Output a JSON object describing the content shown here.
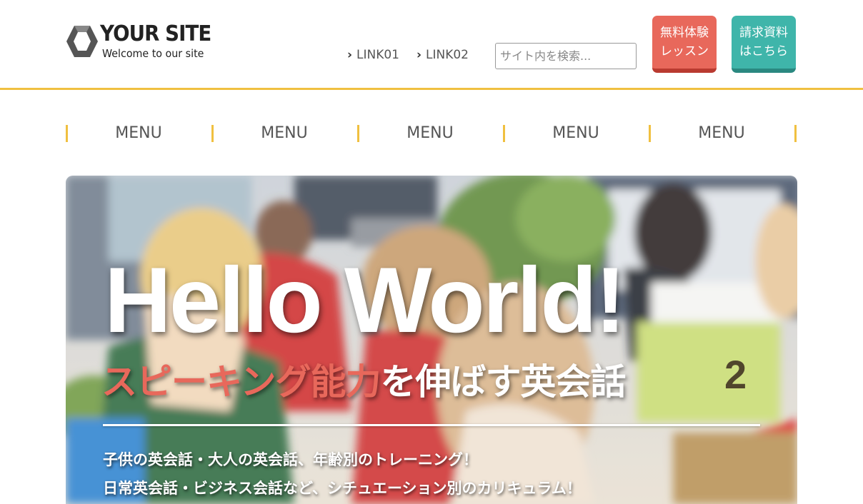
{
  "header": {
    "logo_title": "YOUR SITE",
    "logo_tagline": "Welcome to our site",
    "links": [
      {
        "label": "LINK01"
      },
      {
        "label": "LINK02"
      }
    ],
    "search_placeholder": "サイト内を検索...",
    "cta_trial": "無料体験\nレッスン",
    "cta_request": "請求資料\nはこちら",
    "accent_color": "#f0c040",
    "cta_trial_color": "#e8685b",
    "cta_request_color": "#3fb5aa"
  },
  "menu": {
    "items": [
      "MENU",
      "MENU",
      "MENU",
      "MENU",
      "MENU"
    ]
  },
  "hero": {
    "title": "Hello World!",
    "subtitle_accent": "スピーキング能力",
    "subtitle_rest": "を伸ばす英会話",
    "line1": "子供の英会話・大人の英会話、年齢別のトレーニング！",
    "line2": "日常英会話・ビジネス会話など、シチュエーション別のカリキュラム！"
  }
}
